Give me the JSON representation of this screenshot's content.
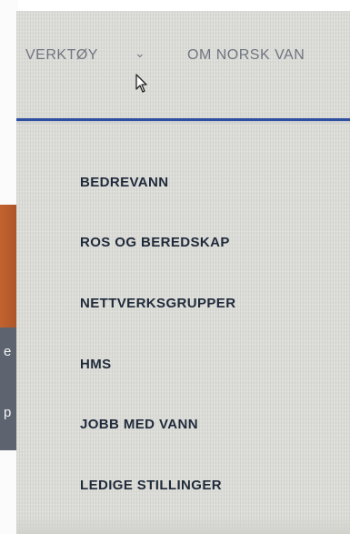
{
  "nav": {
    "items": [
      {
        "label": "VERKTØY",
        "icon": "chevron-down-icon"
      },
      {
        "label": "OM NORSK VAN"
      }
    ]
  },
  "dropdown": {
    "items": [
      {
        "label": "BEDREVANN"
      },
      {
        "label": "ROS OG BEREDSKAP"
      },
      {
        "label": "NETTVERKSGRUPPER"
      },
      {
        "label": "HMS"
      },
      {
        "label": "JOBB MED VANN"
      },
      {
        "label": "LEDIGE STILLINGER"
      }
    ]
  },
  "colors": {
    "accent": "#2f4fa0",
    "menu_text": "#1f2a3a",
    "nav_text": "#6f7580",
    "panel_bg": "#dcdcd8",
    "side_strip": "#c3632e"
  }
}
